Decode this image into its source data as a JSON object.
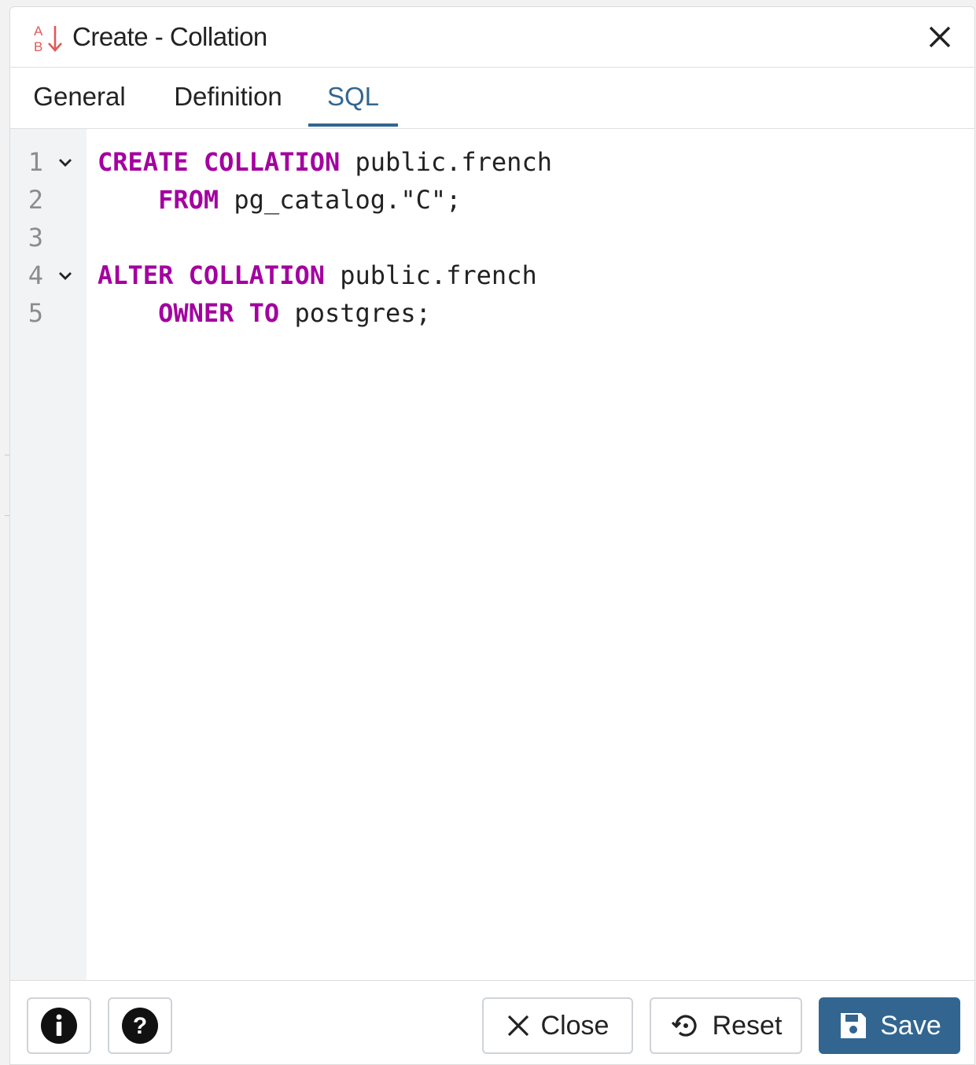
{
  "dialog": {
    "title": "Create - Collation",
    "title_icon": "collation-sort-icon",
    "close_icon": "close-icon"
  },
  "tabs": [
    {
      "label": "General",
      "active": false
    },
    {
      "label": "Definition",
      "active": false
    },
    {
      "label": "SQL",
      "active": true
    }
  ],
  "editor": {
    "lines": [
      {
        "number": "1",
        "foldable": true,
        "tokens": [
          {
            "t": "CREATE COLLATION",
            "kw": true
          },
          {
            "t": " public.french",
            "kw": false
          }
        ]
      },
      {
        "number": "2",
        "foldable": false,
        "tokens": [
          {
            "t": "    ",
            "kw": false
          },
          {
            "t": "FROM",
            "kw": true
          },
          {
            "t": " pg_catalog.\"C\";",
            "kw": false
          }
        ]
      },
      {
        "number": "3",
        "foldable": false,
        "tokens": []
      },
      {
        "number": "4",
        "foldable": true,
        "tokens": [
          {
            "t": "ALTER COLLATION",
            "kw": true
          },
          {
            "t": " public.french",
            "kw": false
          }
        ]
      },
      {
        "number": "5",
        "foldable": false,
        "tokens": [
          {
            "t": "    ",
            "kw": false
          },
          {
            "t": "OWNER TO",
            "kw": true
          },
          {
            "t": " postgres;",
            "kw": false
          }
        ]
      }
    ]
  },
  "footer": {
    "info_icon": "info-icon",
    "help_icon": "help-icon",
    "close_label": "Close",
    "reset_label": "Reset",
    "save_label": "Save"
  },
  "colors": {
    "accent": "#326690",
    "keyword": "#a3009f",
    "title_icon": "#e05a5a"
  }
}
